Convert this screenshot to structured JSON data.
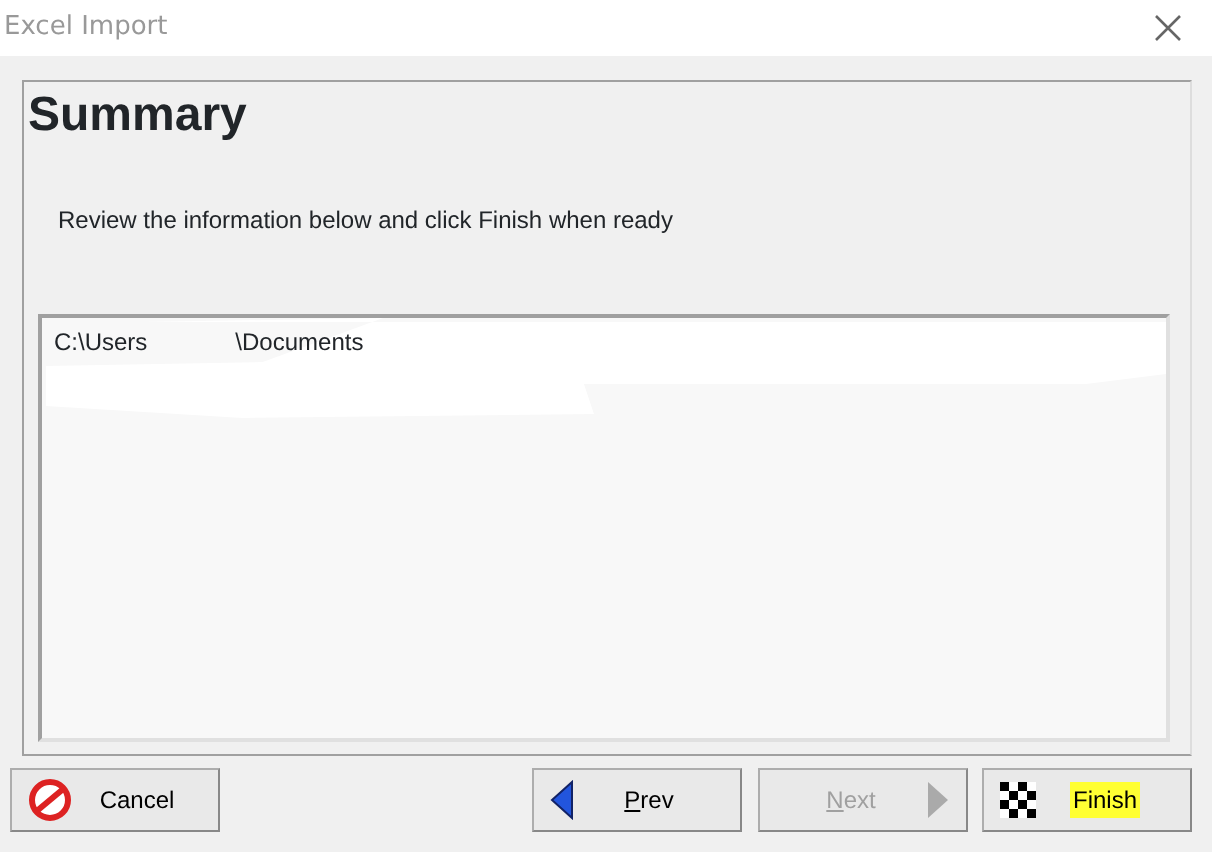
{
  "window": {
    "title": "Excel Import"
  },
  "page": {
    "heading": "Summary",
    "instruction": "Review the information below and click Finish when ready"
  },
  "summary_box": {
    "lines": [
      "C:\\Users",
      "\\Documents"
    ]
  },
  "buttons": [
    {
      "kind": "cancel",
      "label": "Cancel",
      "disabled": false,
      "mnemonic": false,
      "highlighted": false
    },
    {
      "kind": "prev",
      "label": "Prev",
      "disabled": false,
      "mnemonic": true,
      "highlighted": false
    },
    {
      "kind": "next",
      "label": "Next",
      "disabled": true,
      "mnemonic": true,
      "highlighted": false
    },
    {
      "kind": "finish",
      "label": "Finish",
      "disabled": false,
      "mnemonic": false,
      "highlighted": true
    }
  ]
}
